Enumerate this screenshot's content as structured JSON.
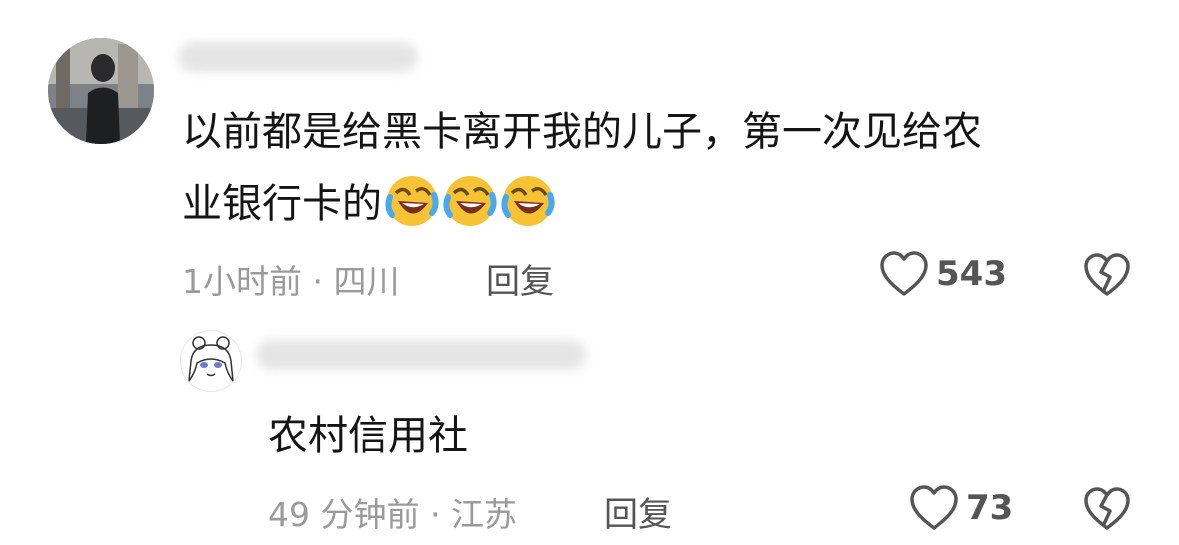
{
  "comments": [
    {
      "text_line1": "以前都是给黑卡离开我的儿子，第一次见给农",
      "text_line2": "业银行卡的",
      "emoji_name": "rofl-emoji",
      "time_location": "1小时前 · 四川",
      "reply_label": "回复",
      "like_count": "543"
    }
  ],
  "replies": [
    {
      "text": "农村信用社",
      "time_location": "49 分钟前 · 江苏",
      "reply_label": "回复",
      "like_count": "73"
    }
  ],
  "icons": {
    "like": "heart-outline-icon",
    "dislike": "broken-heart-icon"
  },
  "colors": {
    "text": "#141414",
    "meta": "#9a9a9a",
    "icon": "#555555",
    "emoji": "#f7c234"
  }
}
